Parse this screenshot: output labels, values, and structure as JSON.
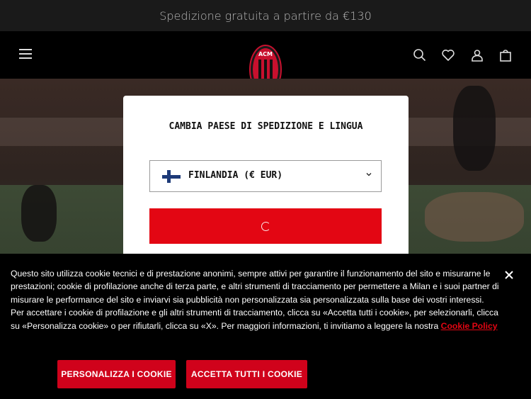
{
  "announcement": {
    "text": "Spedizione gratuita a partire da €130"
  },
  "header": {
    "logo_text": "ACM 1899",
    "icons": [
      "menu-icon",
      "search-icon",
      "heart-icon",
      "user-icon",
      "cart-icon"
    ]
  },
  "modal": {
    "title": "CAMBIA PAESE DI SPEDIZIONE E LINGUA",
    "selected_country": "FINLANDIA (€ EUR)",
    "flag": "finland-flag",
    "button_state": "loading"
  },
  "cookie_banner": {
    "text": "Questo sito utilizza cookie tecnici e di prestazione anonimi, sempre attivi per garantire il funzionamento del sito e misurarne le prestazioni; cookie di profilazione anche di terza parte, e altri strumenti di tracciamento per permettere a Milan e i suoi partner di misurare le performance del sito e inviarvi sia pubblicità non personalizzata sia personalizzata sulla base dei vostri interessi. Per accettare i cookie di profilazione e gli altri strumenti di tracciamento, clicca su «Accetta tutti i cookie», per selezionarli, clicca su «Personalizza cookie» o per rifiutarli, clicca su «X». Per maggiori informazioni, ti invitiamo a leggere la nostra",
    "link_label": "Cookie Policy",
    "personalize_label": "PERSONALIZZA I COOKIE",
    "accept_label": "ACCETTA TUTTI I COOKIE"
  },
  "colors": {
    "brand_red": "#e30613",
    "finland_blue": "#1d3a78"
  }
}
